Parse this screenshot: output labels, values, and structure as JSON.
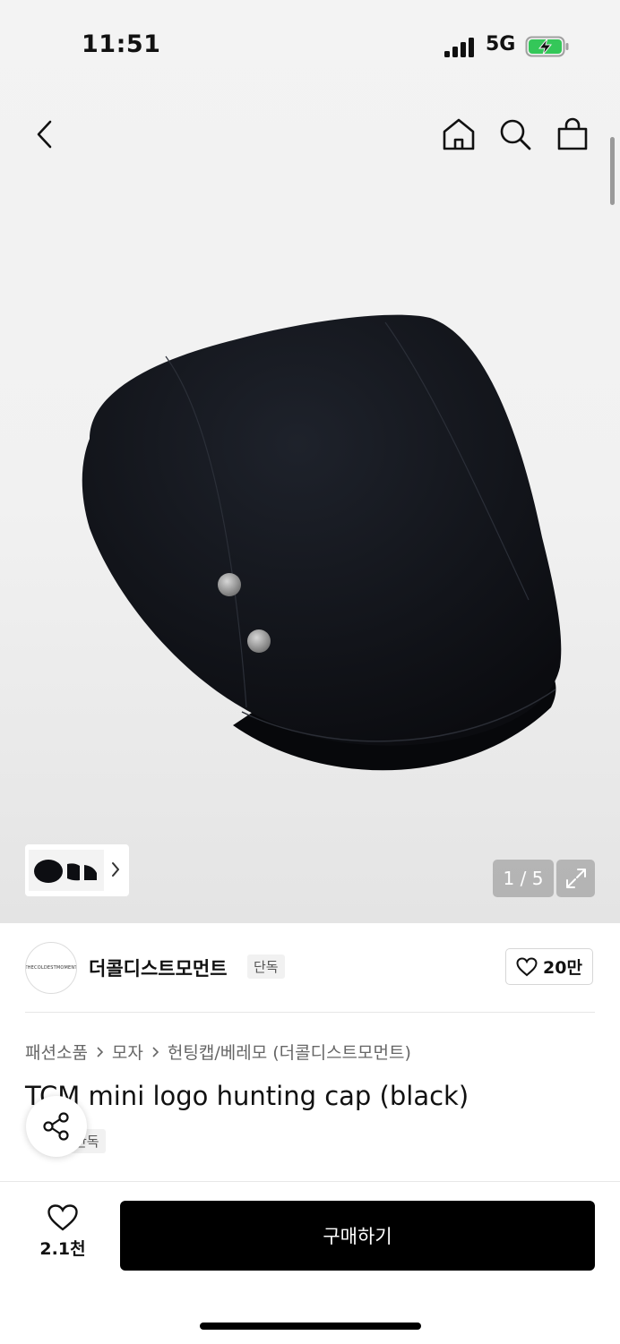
{
  "status_bar": {
    "time": "11:51",
    "network": "5G",
    "battery_color": "#34c759"
  },
  "nav": {
    "back_icon": "chevron-left-icon",
    "home_icon": "home-icon",
    "search_icon": "search-icon",
    "bag_icon": "shopping-bag-icon"
  },
  "gallery": {
    "counter": "1 / 5",
    "current": 1,
    "total": 5,
    "fullscreen_icon": "expand-icon"
  },
  "brand": {
    "logo_text": "THECOLDESTMOMENT",
    "name": "더콜디스트모먼트",
    "tag": "단독",
    "likes": "20만"
  },
  "breadcrumb": [
    "패션소품",
    "모자",
    "헌팅캡/베레모 (더콜디스트모먼트)"
  ],
  "product": {
    "title": "TCM mini logo hunting cap (black)",
    "tag": "단독"
  },
  "bottom_bar": {
    "wish_count": "2.1천",
    "buy_label": "구매하기"
  },
  "colors": {
    "buy_button": "#000000",
    "accent_text": "#111111"
  }
}
